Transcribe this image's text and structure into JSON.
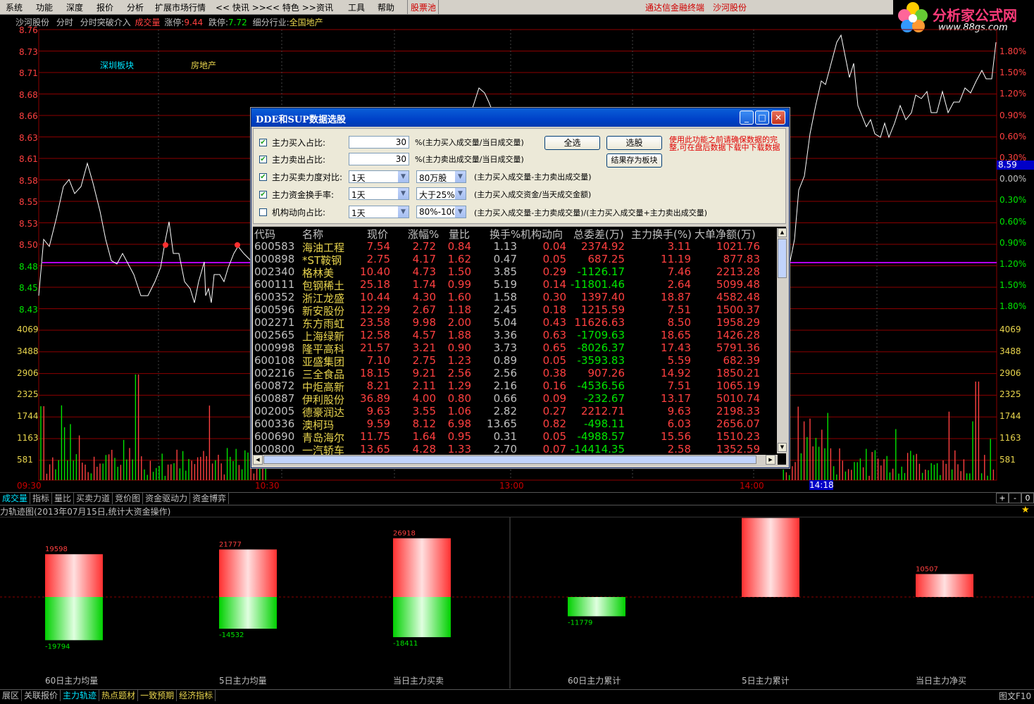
{
  "menu": {
    "items": [
      "系统",
      "功能",
      "深度",
      "报价",
      "分析",
      "扩展市场行情",
      "<< 快讯 >>",
      "<< 特色 >>",
      "资讯",
      "工具",
      "帮助",
      "股票池"
    ],
    "right_links": [
      "通达信金融终端",
      "沙河股份"
    ]
  },
  "logo": {
    "title": "分析家公式网",
    "url": "www.88gs.com"
  },
  "info": {
    "stock": "沙河股份",
    "mode": "分时",
    "indicator": "分时突破介入",
    "volume_label": "成交量",
    "limit_up_label": "涨停:",
    "limit_up": "9.44",
    "limit_down_label": "跌停:",
    "limit_down": "7.72",
    "industry_label": "细分行业:",
    "industry": "全国地产"
  },
  "chart_tags": {
    "block": "深圳板块",
    "sector": "房地产"
  },
  "price_axis_left": [
    "8.76",
    "8.73",
    "8.71",
    "8.68",
    "8.66",
    "8.63",
    "8.61",
    "8.58",
    "8.55",
    "8.53",
    "8.50",
    "8.48",
    "8.45",
    "8.43"
  ],
  "price_axis_right": [
    "1.80%",
    "1.50%",
    "1.20%",
    "0.90%",
    "0.60%",
    "0.30%",
    "0.00%",
    "0.30%",
    "0.60%",
    "0.90%",
    "1.20%",
    "1.50%",
    "1.80%"
  ],
  "current_price": "8.59",
  "volume_axis": [
    "4069",
    "3488",
    "2906",
    "2325",
    "1744",
    "1163",
    "581"
  ],
  "time_axis": [
    "09:30",
    "10:30",
    "13:00",
    "14:00",
    "14:18"
  ],
  "indicator_tabs": [
    "成交量",
    "指标",
    "量比",
    "买卖力道",
    "竞价图",
    "资金驱动力",
    "资金博弈"
  ],
  "zoom_controls": [
    "+",
    "-",
    "0"
  ],
  "panel_title": "力轨迹图(2013年07月15日,统计大资金操作)",
  "bottom_tabs": [
    "展区",
    "关联报价",
    "主力轨迹",
    "热点题材",
    "一致预期",
    "经济指标"
  ],
  "bottom_right": "图文F10",
  "colors": {
    "up": "#ff4040",
    "down": "#00e600",
    "avg_line": "#b400ff",
    "price_line": "#ffffff",
    "grid": "#8b0000"
  },
  "dialog": {
    "title": "DDE和SUP数据选股",
    "filters": [
      {
        "checked": true,
        "label": "主力买入占比:",
        "value": "30",
        "desc": "%(主力买入成交量/当日成交量)"
      },
      {
        "checked": true,
        "label": "主力卖出占比:",
        "value": "30",
        "desc": "%(主力卖出成交量/当日成交量)"
      },
      {
        "checked": true,
        "label": "主力买卖力度对比:",
        "period": "1天",
        "option": "80万股",
        "desc": "(主力买入成交量-主力卖出成交量)"
      },
      {
        "checked": true,
        "label": "主力资金换手率:",
        "period": "1天",
        "option": "大于25%",
        "desc": "(主力买入成交资金/当天成交金额)"
      },
      {
        "checked": false,
        "label": "机构动向占比:",
        "period": "1天",
        "option": "80%-100%",
        "desc": "(主力买入成交量-主力卖成交量)/(主力买入成交量+主力卖出成交量)"
      }
    ],
    "btn_select_all": "全选",
    "btn_pick": "选股",
    "btn_save": "结果存为板块",
    "note": "使用此功能之前请确保数据的完整,可在盘后数据下载中下载数据",
    "columns": [
      "代码",
      "名称",
      "现价",
      "涨幅%",
      "量比",
      "换手%",
      "机构动向",
      "总委差(万)",
      "主力换手(%)",
      "大单净额(万)"
    ],
    "rows": [
      [
        "600583",
        "海油工程",
        "7.54",
        "2.72",
        "0.84",
        "1.13",
        "0.04",
        "2374.92",
        "3.11",
        "1021.76"
      ],
      [
        "000898",
        "*ST鞍钢",
        "2.75",
        "4.17",
        "1.62",
        "0.47",
        "0.05",
        "687.25",
        "11.19",
        "877.83"
      ],
      [
        "002340",
        "格林美",
        "10.40",
        "4.73",
        "1.50",
        "3.85",
        "0.29",
        "-1126.17",
        "7.46",
        "2213.28"
      ],
      [
        "600111",
        "包钢稀土",
        "25.18",
        "1.74",
        "0.99",
        "5.19",
        "0.14",
        "-11801.46",
        "2.64",
        "5099.48"
      ],
      [
        "600352",
        "浙江龙盛",
        "10.44",
        "4.30",
        "1.60",
        "1.58",
        "0.30",
        "1397.40",
        "18.87",
        "4582.48"
      ],
      [
        "600596",
        "新安股份",
        "12.29",
        "2.67",
        "1.18",
        "2.45",
        "0.18",
        "1215.59",
        "7.51",
        "1500.37"
      ],
      [
        "002271",
        "东方雨虹",
        "23.58",
        "9.98",
        "2.00",
        "5.04",
        "0.43",
        "11626.63",
        "8.50",
        "1958.29"
      ],
      [
        "002565",
        "上海绿新",
        "12.58",
        "4.57",
        "1.88",
        "3.36",
        "0.63",
        "-1709.63",
        "18.65",
        "1426.28"
      ],
      [
        "000998",
        "隆平高科",
        "21.57",
        "3.21",
        "0.90",
        "3.73",
        "0.65",
        "-8026.37",
        "17.43",
        "5791.36"
      ],
      [
        "600108",
        "亚盛集团",
        "7.10",
        "2.75",
        "1.23",
        "0.89",
        "0.05",
        "-3593.83",
        "5.59",
        "682.39"
      ],
      [
        "002216",
        "三全食品",
        "18.15",
        "9.21",
        "2.56",
        "2.56",
        "0.38",
        "907.26",
        "14.92",
        "1850.21"
      ],
      [
        "600872",
        "中炬高新",
        "8.21",
        "2.11",
        "1.29",
        "2.16",
        "0.16",
        "-4536.56",
        "7.51",
        "1065.19"
      ],
      [
        "600887",
        "伊利股份",
        "36.89",
        "4.00",
        "0.80",
        "0.66",
        "0.09",
        "-232.67",
        "13.17",
        "5010.74"
      ],
      [
        "002005",
        "德豪润达",
        "9.63",
        "3.55",
        "1.06",
        "2.82",
        "0.27",
        "2212.71",
        "9.63",
        "2198.33"
      ],
      [
        "600336",
        "澳柯玛",
        "9.59",
        "8.12",
        "6.98",
        "13.65",
        "0.82",
        "-498.11",
        "6.03",
        "2656.07"
      ],
      [
        "600690",
        "青岛海尔",
        "11.75",
        "1.64",
        "0.95",
        "0.31",
        "0.05",
        "-4988.57",
        "15.56",
        "1510.23"
      ],
      [
        "000800",
        "一汽轿车",
        "13.65",
        "4.28",
        "1.33",
        "2.70",
        "0.07",
        "-14414.35",
        "2.58",
        "1352.59"
      ]
    ]
  },
  "flow_chart": {
    "groups": [
      {
        "caption": "60日主力均量",
        "pos": "19598",
        "neg": "-19794"
      },
      {
        "caption": "5日主力均量",
        "pos": "21777",
        "neg": "-14532"
      },
      {
        "caption": "当日主力买卖",
        "pos": "26918",
        "neg": "-18411"
      },
      {
        "caption": "60日主力累计",
        "pos": "",
        "neg": "-11779"
      },
      {
        "caption": "5日主力累计",
        "pos": "36226",
        "neg": ""
      },
      {
        "caption": "当日主力净买",
        "pos": "10507",
        "neg": ""
      }
    ]
  }
}
